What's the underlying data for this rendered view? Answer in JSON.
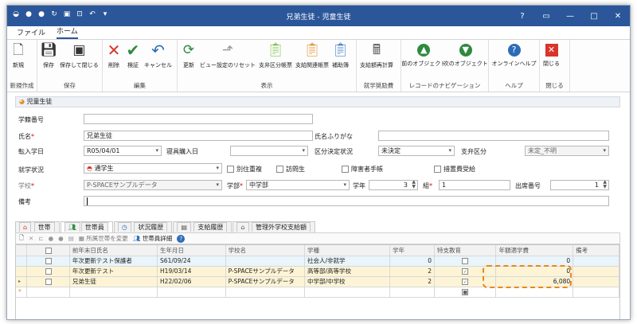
{
  "window": {
    "title": "兄弟生徒 - 児童生徒"
  },
  "menu": {
    "file": "ファイル",
    "home": "ホーム"
  },
  "ribbon": {
    "groups": {
      "new": "新規作成",
      "save": "保存",
      "edit": "編集",
      "display": "表示",
      "calc": "就学奨励費",
      "nav": "レコードのナビゲーション",
      "help": "ヘルプ",
      "close": "閉じる"
    },
    "buttons": {
      "new": "新規",
      "save": "保存",
      "save_close": "保存して閉じる",
      "delete": "削除",
      "check": "検証",
      "cancel": "キャンセル",
      "refresh": "更新",
      "reset_view": "ビュー設定のリセット",
      "shikyu_ledger": "支弁区分帳票",
      "shikyu_related": "支給関連帳票",
      "hosoku": "補助簿",
      "recalc": "支給額再計算",
      "prev": "前のオブジェクト",
      "next": "次のオブジェクト",
      "online_help": "オンラインヘルプ",
      "close": "閉じる"
    }
  },
  "section": {
    "title": "児童生徒"
  },
  "form": {
    "gakuseki_label": "学籍番号",
    "gakuseki_value": "",
    "name_label": "氏名",
    "name_value": "兄弟生徒",
    "kana_label": "氏名ふりがな",
    "kana_value": "",
    "tennyu_label": "転入学日",
    "tennyu_value": "R05/04/01",
    "shingu_label": "寝具購入日",
    "shingu_value": "",
    "kubun_label": "区分決定状況",
    "kubun_value": "未決定",
    "shiben_label": "支弁区分",
    "shiben_value": "未定_不明",
    "shugaku_label": "就学状況",
    "shugaku_value": "通学生",
    "cb_betsu": "別住重複",
    "cb_houmon": "訪問生",
    "cb_shogai": "障害者手帳",
    "cb_sochi": "措置費受給",
    "school_label": "学校",
    "school_value": "P-SPACEサンプルデータ",
    "bu_label": "学部",
    "bu_value": "中学部",
    "nen_label": "学年",
    "nen_value": "3",
    "kumi_label": "組",
    "kumi_value": "1",
    "shusseki_label": "出席番号",
    "shusseki_value": "1",
    "biko_label": "備考",
    "biko_value": ""
  },
  "tabs": [
    "世帯",
    "世帯員",
    "状況履歴",
    "支給履歴",
    "管理外学校支給額"
  ],
  "gridtoolbar": {
    "change": "所属世帯を変更",
    "detail": "世帯員詳細"
  },
  "grid": {
    "headers": [
      "前年末日氏名",
      "生年月日",
      "学校名",
      "学種",
      "学年",
      "特支教育",
      "年額適学費",
      "備考"
    ],
    "rows": [
      {
        "name": "年次更新テスト保護者",
        "dob": "S61/09/24",
        "school": "",
        "type": "社会人/非就学",
        "grade": "0",
        "tokushi": false,
        "amount": "0",
        "note": ""
      },
      {
        "name": "年次更新テスト",
        "dob": "H19/03/14",
        "school": "P-SPACEサンプルデータ",
        "type": "高等部/高等学校",
        "grade": "2",
        "tokushi": true,
        "amount": "0",
        "note": ""
      },
      {
        "name": "兄弟生徒",
        "dob": "H22/02/06",
        "school": "P-SPACEサンプルデータ",
        "type": "中学部/中学校",
        "grade": "2",
        "tokushi": true,
        "amount": "6,080",
        "note": ""
      }
    ]
  },
  "colors": {
    "titlebar": "#2b579a",
    "highlight": "#e8871e"
  }
}
